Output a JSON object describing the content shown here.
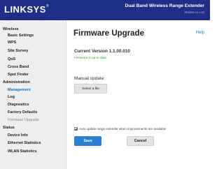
{
  "header": {
    "logo": "LINKSYS",
    "logo_mark": "®",
    "product_title": "Dual Band Wireless Range Extender",
    "product_model": "RE6300 v1.1.00"
  },
  "sidebar": {
    "sections": [
      {
        "label": "Wireless"
      },
      {
        "label": "Administration"
      },
      {
        "label": "Status"
      }
    ],
    "items": [
      {
        "label": "Basic Settings"
      },
      {
        "label": "WPS"
      },
      {
        "label": "Site Survey"
      },
      {
        "label": "QoS"
      },
      {
        "label": "Cross Band"
      },
      {
        "label": "Spot Finder"
      },
      {
        "label": "Management"
      },
      {
        "label": "Log"
      },
      {
        "label": "Diagnostics"
      },
      {
        "label": "Factory Defaults"
      },
      {
        "label": "Firmware Upgrade"
      },
      {
        "label": "Device Info"
      },
      {
        "label": "Ethernet Statistics"
      },
      {
        "label": "WLAN Statistics"
      }
    ],
    "active_item": "Management"
  },
  "main": {
    "title": "Firmware Upgrade",
    "help_label": "Help",
    "current_version": "Current Version 1.1.00.010",
    "status_text": "Firmware is up-to-date",
    "manual_update_label": "Manual update",
    "select_file_label": "Select a file",
    "auto_update_label": "Auto update range extender when improvements are available",
    "auto_update_checked": true,
    "save_label": "Save",
    "cancel_label": "Cancel"
  },
  "colors": {
    "header_bg": "#1f2e87",
    "accent": "#2a7fd4",
    "active_link": "#1976c9",
    "status_ok": "#2f9e2f",
    "sidebar_bg": "#eeeeee"
  }
}
